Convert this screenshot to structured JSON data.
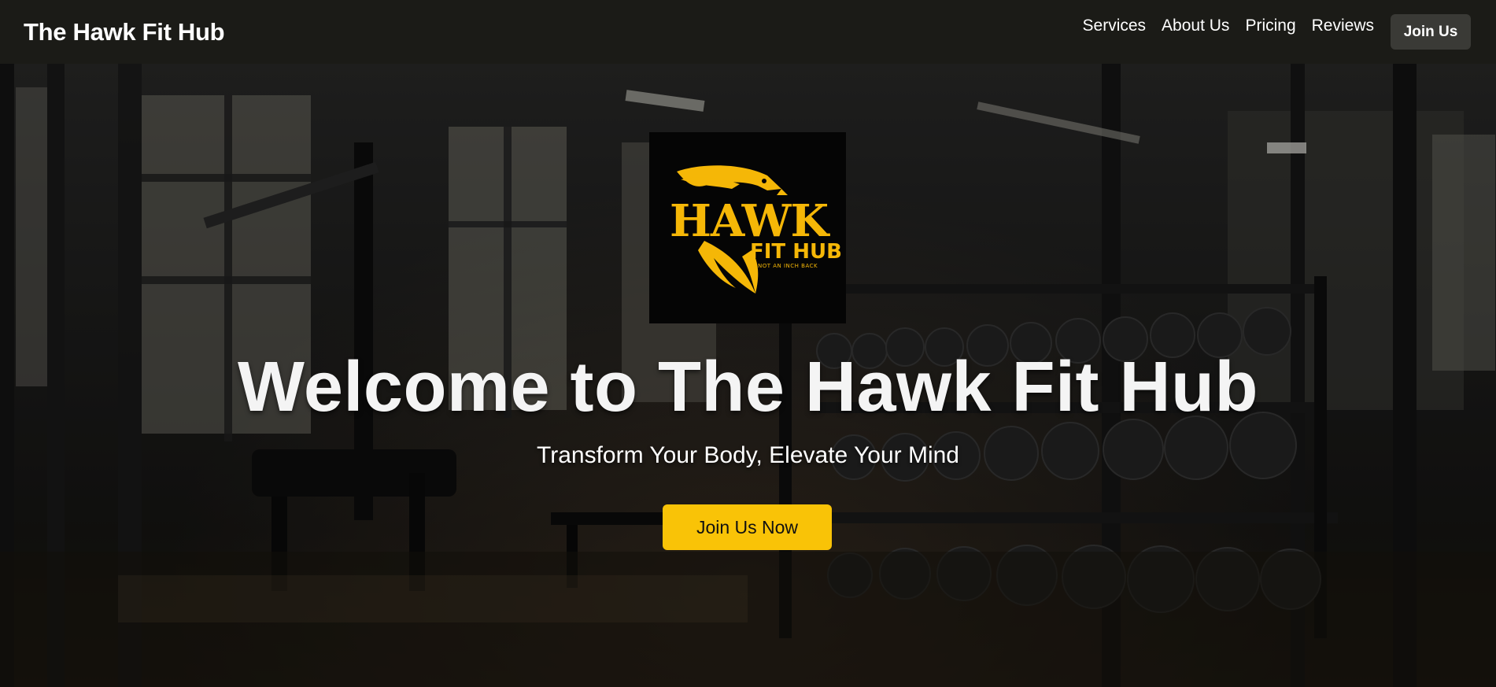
{
  "nav": {
    "brand": "The Hawk Fit Hub",
    "links": [
      {
        "label": "Services"
      },
      {
        "label": "About Us"
      },
      {
        "label": "Pricing"
      },
      {
        "label": "Reviews"
      }
    ],
    "cta_label": "Join Us"
  },
  "hero": {
    "logo": {
      "wordmark": "HAWK",
      "subline": "FIT HUB",
      "tagline": "NOT AN INCH BACK",
      "icon": "hawk-head-icon",
      "accent_color": "#f5b707"
    },
    "title": "Welcome to The Hawk Fit Hub",
    "subtitle": "Transform Your Body, Elevate Your Mind",
    "cta_label": "Join Us Now",
    "cta_color": "#f9c307"
  }
}
